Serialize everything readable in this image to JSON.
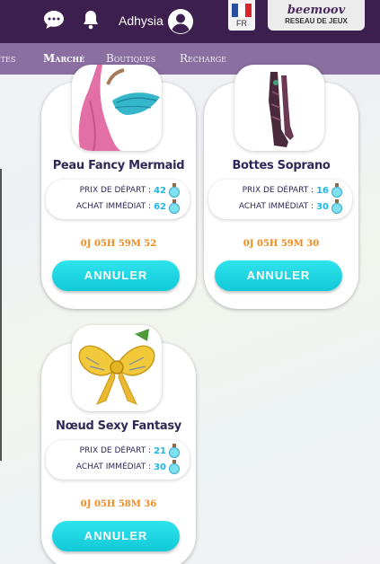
{
  "header": {
    "username": "Adhysia",
    "language_code": "FR",
    "brand_logo": "beemoov",
    "brand_sub": "RESEAU DE JEUX"
  },
  "nav": {
    "items": [
      {
        "label": "Bêtes"
      },
      {
        "label": "Marché"
      },
      {
        "label": "Boutiques"
      },
      {
        "label": "Recharge"
      }
    ],
    "active": "Marché"
  },
  "labels": {
    "start_price": "PRIX DE DÉPART :",
    "buy_now": "ACHAT IMMÉDIAT :",
    "cancel": "ANNULER"
  },
  "listings": [
    {
      "name": "Peau Fancy Mermaid",
      "start_price": "42",
      "buy_now": "62",
      "timer": "0J 05H 59M 52"
    },
    {
      "name": "Bottes Soprano",
      "start_price": "16",
      "buy_now": "30",
      "timer": "0J 05H 59M 30"
    },
    {
      "name": "Nœud Sexy Fantasy",
      "start_price": "21",
      "buy_now": "30",
      "timer": "0J 05H 58M 36"
    }
  ],
  "colors": {
    "topbar": "#3c1f4e",
    "nav": "#8a6fa0",
    "price_value": "#1fb6e8",
    "timer": "#f08a1c",
    "cancel_button": "#1fd6e2",
    "item_name": "#2e2957"
  },
  "icons": {
    "chat": "chat-bubble-icon",
    "notifications": "bell-icon",
    "account": "user-avatar-icon",
    "currency": "maana-potion-icon"
  }
}
